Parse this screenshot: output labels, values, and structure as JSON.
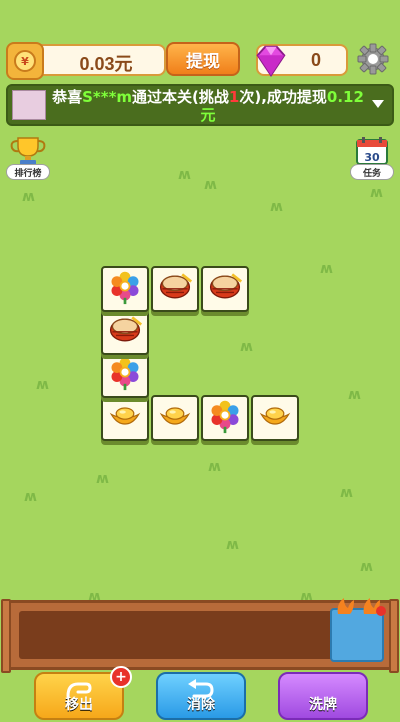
{
  "topbar": {
    "money_symbol": "¥",
    "money_value": "0.03元",
    "withdraw_label": "提现",
    "gem_count": "0"
  },
  "banner": {
    "prefix": "恭喜",
    "user": "S***m",
    "middle": "通过本关(挑战",
    "count": "1",
    "suffix": "次),成功提现",
    "amount": "0.12元"
  },
  "side": {
    "rank_label": "排行榜",
    "task_label": "任务",
    "task_calendar_number": "30"
  },
  "tiles": [
    {
      "icon": "flower-icon",
      "col": 0,
      "row": 0
    },
    {
      "icon": "drum-icon",
      "col": 1,
      "row": 0
    },
    {
      "icon": "drum-icon",
      "col": 2,
      "row": 0
    },
    {
      "icon": "drum-icon",
      "col": 0,
      "row": 1
    },
    {
      "icon": "flower-icon",
      "col": 0,
      "row": 2
    },
    {
      "icon": "gold-ingot-icon",
      "col": 0,
      "row": 3
    },
    {
      "icon": "gold-ingot-icon",
      "col": 1,
      "row": 3
    },
    {
      "icon": "flower-icon",
      "col": 2,
      "row": 3
    },
    {
      "icon": "gold-ingot-icon",
      "col": 3,
      "row": 3
    }
  ],
  "buttons": {
    "remove_label": "移出",
    "remove_badge": "+",
    "undo_label": "消除",
    "shuffle_label": "洗牌"
  },
  "colors": {
    "background": "#a5d65e",
    "tile_face": "#fffbe8",
    "tray_wood": "#b86b3a"
  }
}
